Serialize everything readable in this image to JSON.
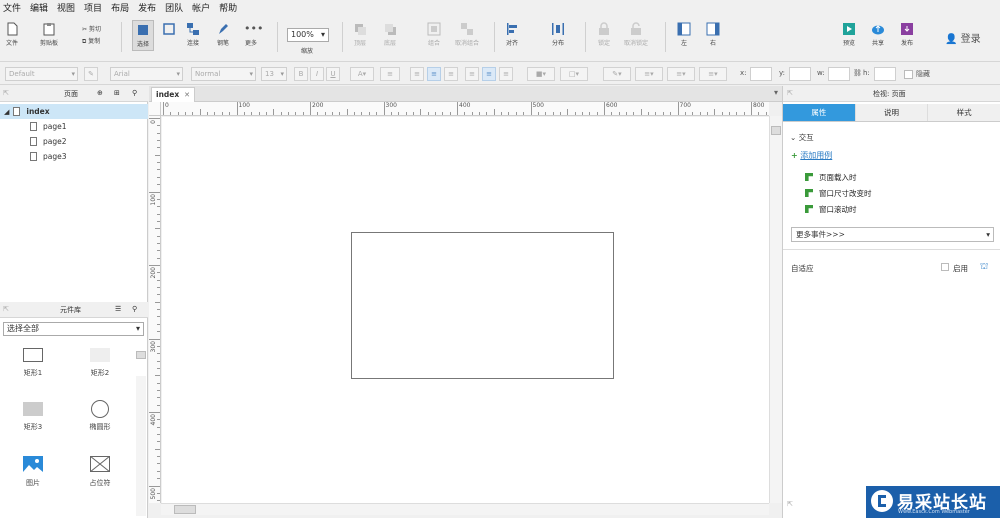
{
  "menu": [
    "文件",
    "编辑",
    "视图",
    "项目",
    "布局",
    "发布",
    "团队",
    "帐户",
    "帮助"
  ],
  "toolbar": {
    "file": "文件",
    "clipboard": "剪贴板",
    "cut": "剪切",
    "copy": "复制",
    "select": "选择",
    "connect": "连接",
    "pen": "钢笔",
    "more": "更多",
    "zoom": "100%",
    "zoom_label": "缩放",
    "top": "顶层",
    "bottom": "底层",
    "group": "组合",
    "ungroup": "取消组合",
    "align": "对齐",
    "distribute": "分布",
    "lock": "锁定",
    "unlock": "取消锁定",
    "left": "左",
    "right": "右",
    "preview": "预览",
    "share": "共享",
    "publish": "发布",
    "login": "登录"
  },
  "formatbar": {
    "style": "Default",
    "font": "Arial",
    "weight": "Normal",
    "size": "13",
    "x_label": "x:",
    "y_label": "y:",
    "w_label": "w:",
    "h_label": "h:",
    "hide": "隐藏"
  },
  "pages_panel": {
    "title": "页面",
    "items": [
      {
        "label": "index",
        "selected": true
      },
      {
        "label": "page1"
      },
      {
        "label": "page2"
      },
      {
        "label": "page3"
      }
    ]
  },
  "library": {
    "title": "元件库",
    "selected": "选择全部",
    "widgets": [
      "矩形1",
      "矩形2",
      "矩形3",
      "椭圆形",
      "图片",
      "占位符"
    ]
  },
  "canvas": {
    "tab": "index",
    "ruler_h": [
      "0",
      "100",
      "200",
      "300",
      "400",
      "500",
      "600",
      "700",
      "800"
    ],
    "ruler_v": [
      "0",
      "100",
      "200",
      "300",
      "400",
      "500"
    ]
  },
  "inspector": {
    "title": "检视: 页面",
    "tabs": [
      "属性",
      "说明",
      "样式"
    ],
    "interaction": "交互",
    "add_case": "添加用例",
    "events": [
      "页面载入时",
      "窗口尺寸改变时",
      "窗口滚动时"
    ],
    "more_events": "更多事件>>>",
    "adaptive": "自适应",
    "enable": "启用"
  },
  "watermark": {
    "text": "易采站长站",
    "sub": "Www.Easck.Com Webmaster"
  },
  "colors": {
    "accent": "#3399dd",
    "selection": "#cde6f7",
    "watermark": "#1b5faa"
  }
}
